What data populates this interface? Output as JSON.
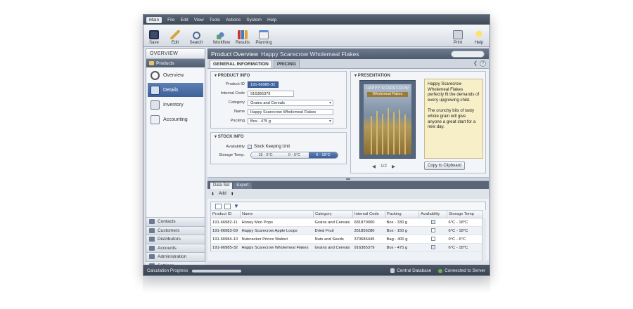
{
  "menubar": {
    "items": [
      "Main",
      "File",
      "Edit",
      "View",
      "Tools",
      "Actions",
      "System",
      "Help"
    ]
  },
  "toolbar": {
    "left": [
      "Save",
      "Edit",
      "Search",
      "Workflow",
      "Results",
      "Planning"
    ],
    "right": [
      "Print",
      "Help"
    ]
  },
  "sidebar": {
    "header": "OVERVIEW",
    "section": "Products",
    "items": [
      {
        "label": "Overview",
        "icon": "gauge-icon"
      },
      {
        "label": "Details",
        "icon": "details-icon"
      },
      {
        "label": "Inventory",
        "icon": "inventory-icon"
      },
      {
        "label": "Accounting",
        "icon": "accounting-icon"
      }
    ],
    "bottom": [
      "Contacts",
      "Customers",
      "Distributors",
      "Accounts",
      "Administration",
      "Settings"
    ]
  },
  "overview": {
    "title": "Product Overview",
    "product": "Happy Scarecrow Wholemeal Flakes"
  },
  "tabs": [
    "GENERAL INFORMATION",
    "PRICING"
  ],
  "product_info": {
    "header": "PRODUCT INFO",
    "fields": [
      {
        "label": "Product ID",
        "value": "191-66985-32"
      },
      {
        "label": "Internal Code",
        "value": "916385379"
      },
      {
        "label": "Category",
        "value": "Grains and Cereals"
      },
      {
        "label": "Name",
        "value": "Happy Scarecrow Wholemeal Flakes"
      },
      {
        "label": "Packing",
        "value": "Box - 475 g"
      }
    ]
  },
  "stock_info": {
    "header": "STOCK INFO",
    "availability_label": "Availability",
    "availability_value": "Stock Keeping Unit",
    "temp_label": "Storage Temp.",
    "temps": [
      "18 - 0°C",
      "0 - 6°C",
      "6 - 18°C"
    ],
    "selected_temp": 2
  },
  "presentation": {
    "header": "PRESENTATION",
    "book_title": "HAPPY SCARECROW",
    "book_subtitle": "Wholemeal Flakes",
    "note_p1": "Happy Scarecrow Wholemeal Flakes perfectly fit the demands of every upgrowing child.",
    "note_p2": "The crunchy bits of tasty whole grain will give anyone a great start for a new day.",
    "pager": "1/2",
    "copy_button": "Copy to Clipboard"
  },
  "grid": {
    "tabs": [
      "Data Set",
      "Export"
    ],
    "tools_label": "Add",
    "columns": [
      "Product ID",
      "Name",
      "Category",
      "Internal Code",
      "Packing",
      "Availability",
      "Storage Temp"
    ],
    "rows": [
      {
        "id": "191-66982-11",
        "name": "Honey Moo Pops",
        "category": "Grains and Cereals",
        "code": "681879000",
        "packing": "Box - 330 g",
        "avail": true,
        "temp": "6°C - 18°C"
      },
      {
        "id": "191-66983-59",
        "name": "Happy Scarecrow Apple Loops",
        "category": "Dried Fruit",
        "code": "351856280",
        "packing": "Box - 150 g",
        "avail": false,
        "temp": "6°C - 18°C"
      },
      {
        "id": "191-66984-10",
        "name": "Nutcracker Prince Walnut",
        "category": "Nuts and Seeds",
        "code": "370686445",
        "packing": "Bag - 400 g",
        "avail": false,
        "temp": "0°C - 6°C"
      },
      {
        "id": "191-66985-32",
        "name": "Happy Scarecrow Wholemeal Flakes",
        "category": "Grains and Cereals",
        "code": "916385379",
        "packing": "Box - 475 g",
        "avail": true,
        "temp": "6°C - 18°C"
      }
    ]
  },
  "status": {
    "left": "Calculation Progress",
    "db": "Central Database",
    "conn": "Connected to Server"
  }
}
